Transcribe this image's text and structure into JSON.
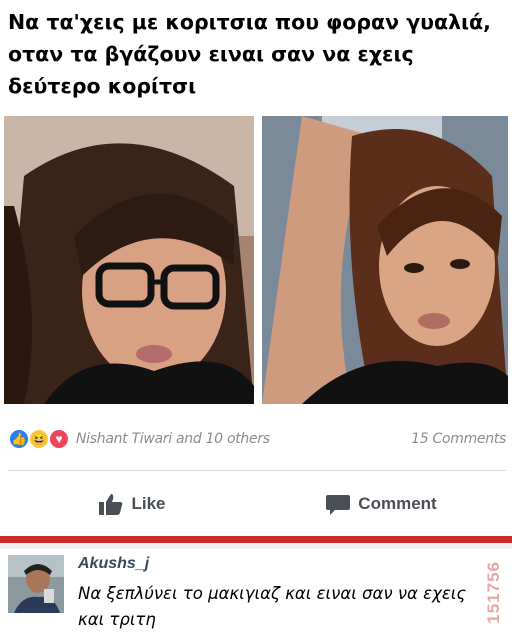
{
  "caption": "Να τα'χεις με κοριτσια που φοραν γυαλιά, οταν τα βγάζουν ειναι σαν να εχεις δεύτερο κορίτσι",
  "post": {
    "reactions": [
      "like",
      "haha",
      "love"
    ],
    "reactions_text": "Nishant Tiwari and 10 others",
    "comments_count": "15 Comments"
  },
  "actions": {
    "like_label": "Like",
    "comment_label": "Comment"
  },
  "comment": {
    "author": "Akushs_j",
    "text": "Να ξεπλύνει το μακιγιαζ και ειναι σαν να εχεις και τριτη"
  },
  "watermark": "151756",
  "colors": {
    "like_blue": "#2a7ff2",
    "haha_yellow": "#f7c940",
    "love_red": "#f0455a",
    "divider_red": "#cc2a2a",
    "muted_text": "#8a8d91"
  }
}
